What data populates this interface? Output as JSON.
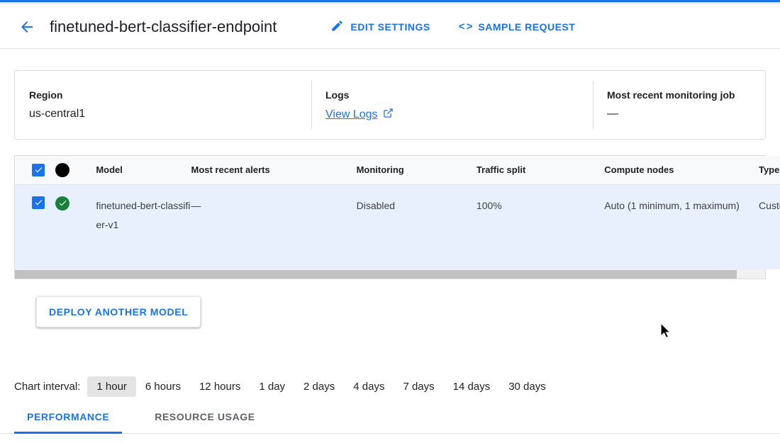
{
  "header": {
    "back_icon": "arrow-left-icon",
    "title": "finetuned-bert-classifier-endpoint",
    "actions": [
      {
        "label": "EDIT SETTINGS",
        "icon": "pencil-icon"
      },
      {
        "label": "SAMPLE REQUEST",
        "icon": "code-brackets-icon"
      }
    ]
  },
  "info_card": {
    "region": {
      "label": "Region",
      "value": "us-central1"
    },
    "logs": {
      "label": "Logs",
      "link_text": "View Logs",
      "icon": "external-link-icon"
    },
    "monitoring_job": {
      "label": "Most recent monitoring job",
      "value": "—"
    }
  },
  "models_table": {
    "columns": [
      "",
      "",
      "Model",
      "Most recent alerts",
      "Monitoring",
      "Traffic split",
      "Compute nodes",
      "Type"
    ],
    "header_select_all_checked": true,
    "header_status_icon": "filled-circle-icon",
    "rows": [
      {
        "selected": true,
        "status_icon": "check-circle-icon",
        "model": "finetuned-bert-classifier-v1",
        "most_recent_alerts": "—",
        "monitoring": "Disabled",
        "traffic_split": "100%",
        "compute_nodes": "Auto (1 minimum, 1 maximum)",
        "type": "Custom trained"
      }
    ]
  },
  "deploy_button": {
    "label": "DEPLOY ANOTHER MODEL"
  },
  "chart_interval": {
    "label": "Chart interval:",
    "options": [
      "1 hour",
      "6 hours",
      "12 hours",
      "1 day",
      "2 days",
      "4 days",
      "7 days",
      "14 days",
      "30 days"
    ],
    "selected": "1 hour"
  },
  "tabs": [
    {
      "label": "PERFORMANCE",
      "active": true
    },
    {
      "label": "RESOURCE USAGE",
      "active": false
    }
  ],
  "colors": {
    "accent": "#1a73e8",
    "selected_row": "#e8f0fe",
    "header_bg": "#f8f9fa",
    "status_green": "#188038",
    "border": "#dadce0"
  }
}
